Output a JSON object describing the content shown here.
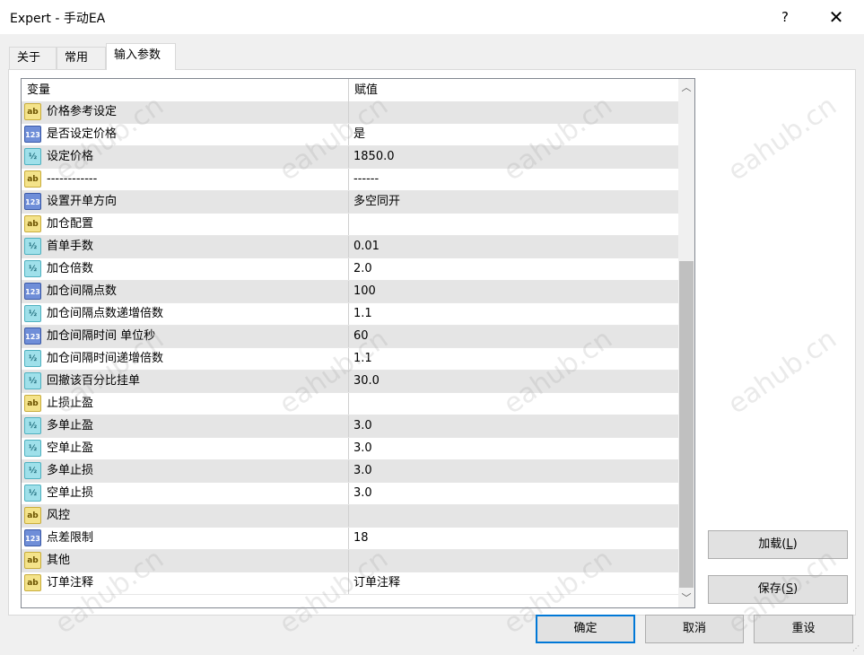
{
  "window": {
    "title": "Expert - 手动EA",
    "help_label": "?",
    "close_label": "✕"
  },
  "tabs": [
    {
      "label": "关于"
    },
    {
      "label": "常用"
    },
    {
      "label": "输入参数"
    }
  ],
  "grid": {
    "col_var": "变量",
    "col_val": "赋值",
    "rows": [
      {
        "type": "ab",
        "name": "价格参考设定",
        "value": ""
      },
      {
        "type": "int",
        "name": "是否设定价格",
        "value": "是"
      },
      {
        "type": "dbl",
        "name": "设定价格",
        "value": "1850.0"
      },
      {
        "type": "ab",
        "name": "------------",
        "value": "------"
      },
      {
        "type": "int",
        "name": "设置开单方向",
        "value": "多空同开"
      },
      {
        "type": "ab",
        "name": "加仓配置",
        "value": ""
      },
      {
        "type": "dbl",
        "name": "首单手数",
        "value": "0.01"
      },
      {
        "type": "dbl",
        "name": "加仓倍数",
        "value": "2.0"
      },
      {
        "type": "int",
        "name": "加仓间隔点数",
        "value": "100"
      },
      {
        "type": "dbl",
        "name": "加仓间隔点数递增倍数",
        "value": "1.1"
      },
      {
        "type": "int",
        "name": "加仓间隔时间 单位秒",
        "value": "60"
      },
      {
        "type": "dbl",
        "name": "加仓间隔时间递增倍数",
        "value": "1.1"
      },
      {
        "type": "dbl",
        "name": "回撤该百分比挂单",
        "value": "30.0"
      },
      {
        "type": "ab",
        "name": "止损止盈",
        "value": ""
      },
      {
        "type": "dbl",
        "name": "多单止盈",
        "value": "3.0"
      },
      {
        "type": "dbl",
        "name": "空单止盈",
        "value": "3.0"
      },
      {
        "type": "dbl",
        "name": "多单止损",
        "value": "3.0"
      },
      {
        "type": "dbl",
        "name": "空单止损",
        "value": "3.0"
      },
      {
        "type": "ab",
        "name": "风控",
        "value": ""
      },
      {
        "type": "int",
        "name": "点差限制",
        "value": "18"
      },
      {
        "type": "ab",
        "name": "其他",
        "value": ""
      },
      {
        "type": "ab",
        "name": "订单注释",
        "value": "订单注释"
      }
    ]
  },
  "icons": {
    "ab": "ab",
    "int": "123",
    "dbl": "½"
  },
  "buttons": {
    "load_label": "加载(",
    "load_key": "L",
    "load_tail": ")",
    "save_label": "保存(",
    "save_key": "S",
    "save_tail": ")",
    "ok_label": "确定",
    "cancel_label": "取消",
    "reset_label": "重设"
  },
  "watermark": "eahub.cn"
}
